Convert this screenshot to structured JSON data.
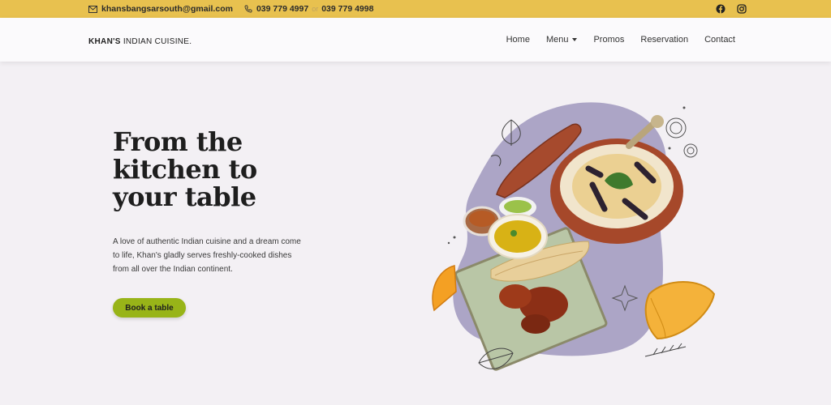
{
  "topbar": {
    "email": "khansbangsarsouth@gmail.com",
    "phone1": "039 779 4997",
    "phone_separator": "or",
    "phone2": "039 779 4998",
    "social": [
      "facebook-icon",
      "instagram-icon"
    ]
  },
  "navbar": {
    "brand_bold": "KHAN'S",
    "brand_rest": " INDIAN CUISINE.",
    "items": [
      {
        "label": "Home"
      },
      {
        "label": "Menu",
        "dropdown": true
      },
      {
        "label": "Promos"
      },
      {
        "label": "Reservation"
      },
      {
        "label": "Contact"
      }
    ]
  },
  "hero": {
    "title_line1": "From the",
    "title_line2": "kitchen to",
    "title_line3": "your table",
    "description": "A love of authentic Indian cuisine and a dream come to life, Khan's gladly serves freshly-cooked dishes from all over the Indian continent.",
    "cta_label": "Book a table"
  },
  "colors": {
    "topbar": "#e8c14f",
    "accent_button": "#98b418",
    "background": "#f3f0f4",
    "blob": "#aca5c6"
  }
}
